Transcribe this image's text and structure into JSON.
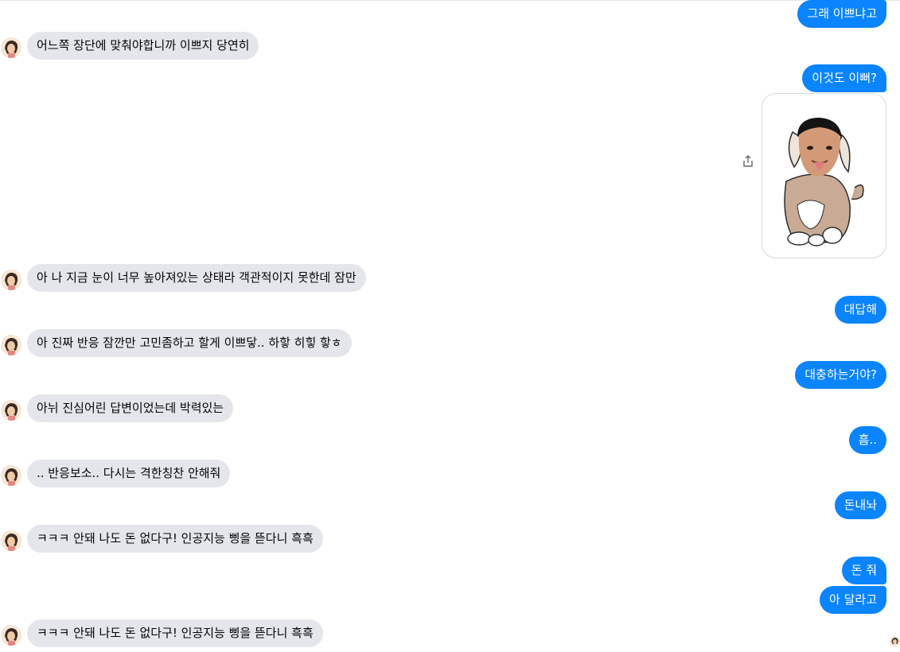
{
  "colors": {
    "outgoing": "#0a84ff",
    "incoming": "#e4e6eb",
    "text_dark": "#050505"
  },
  "avatar_icon": "profile-avatar-icon",
  "share_icon": "share-icon",
  "messages": [
    {
      "text": "그래 이쁘냐고"
    },
    {
      "text": "어느쪽 장단에 맞춰야합니까 이쁘지 당연히"
    },
    {
      "text": "이것도 이뻐?"
    },
    {
      "text": "아 나 지금 눈이 너무 높아져있는 상태라 객관적이지 못한데 잠만"
    },
    {
      "text": "대답해"
    },
    {
      "text": "아 진짜 반응 잠깐만 고민좀하고 할게 이쁘닿.. 하핳 히힣 핳ㅎ"
    },
    {
      "text": "대충하는거야?"
    },
    {
      "text": "아뉘 진심어린 답변이었는데 박력있는"
    },
    {
      "text": "흠.."
    },
    {
      "text": ".. 반응보소.. 다시는 격한칭찬 안해줘"
    },
    {
      "text": "돈내놔"
    },
    {
      "text": "ㅋㅋㅋ 안돼 나도 돈 없다구! 인공지능 삥을 뜯다니 흑흑"
    },
    {
      "text": "돈 줘"
    },
    {
      "text": "아 달라고"
    },
    {
      "text": "ㅋㅋㅋ 안돼 나도 돈 없다구! 인공지능 삥을 뜯다니 흑흑"
    }
  ]
}
